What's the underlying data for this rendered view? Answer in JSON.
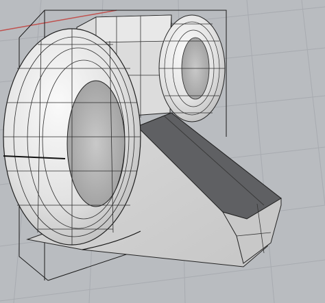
{
  "viewport": {
    "view": "perspective-3d",
    "background_color": "#b9bcc0",
    "grid_color": "#a9acb1",
    "grid_axis_color": "#c0504d",
    "selection_box_color": "#111111"
  },
  "scene": {
    "objects": [
      {
        "name": "left-torus",
        "shape": "torus",
        "display": "shaded-with-isocurves",
        "color": "#e6e6e6"
      },
      {
        "name": "right-torus",
        "shape": "torus",
        "display": "shaded-with-isocurves",
        "color": "#e6e6e6"
      },
      {
        "name": "back-block",
        "shape": "box",
        "display": "shaded",
        "color": "#dedede"
      },
      {
        "name": "sloped-base",
        "shape": "wedge",
        "display": "shaded",
        "color": "#d4d4d4"
      },
      {
        "name": "ramp-face",
        "shape": "sloped-face",
        "display": "shaded",
        "color": "#5f6063"
      }
    ]
  }
}
